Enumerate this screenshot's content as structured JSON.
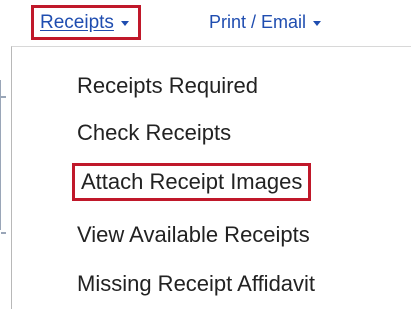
{
  "menubar": {
    "receipts_label": "Receipts",
    "print_email_label": "Print / Email"
  },
  "dropdown": {
    "items": [
      {
        "label": "Receipts Required"
      },
      {
        "label": "Check Receipts"
      },
      {
        "label": "Attach Receipt Images"
      },
      {
        "label": "View Available Receipts"
      },
      {
        "label": "Missing Receipt Affidavit"
      }
    ]
  },
  "colors": {
    "link": "#1f4db0",
    "highlight_border": "#c0182a",
    "menu_text": "#222222"
  }
}
